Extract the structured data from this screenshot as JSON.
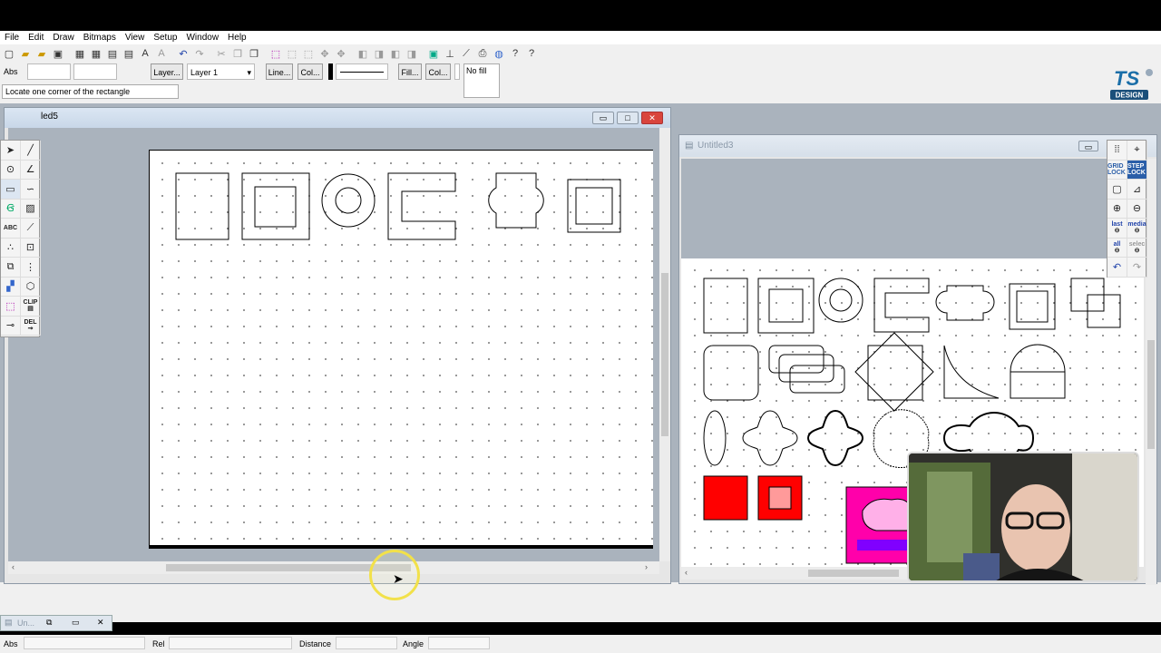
{
  "menu": [
    "File",
    "Edit",
    "Draw",
    "Bitmaps",
    "View",
    "Setup",
    "Window",
    "Help"
  ],
  "propbar": {
    "abs_label": "Abs",
    "layer_button": "Layer...",
    "layer_select": "Layer 1",
    "line_button": "Line...",
    "color_button": "Col...",
    "fill_button": "Fill...",
    "fill_color_button": "Col...",
    "fill_value": "No fill"
  },
  "prompt": "Locate one corner of the rectangle",
  "logo": {
    "text": "TS",
    "sub": "DESIGN"
  },
  "left_window": {
    "title": "led5"
  },
  "right_window": {
    "title": "Untitled3"
  },
  "minimized": {
    "title": "Un..."
  },
  "palette_left": [
    "ABC",
    "CLIP",
    "DEL"
  ],
  "palette_right": [
    "GRID LOCK",
    "STEP LOCK",
    "last",
    "media",
    "all",
    "selec"
  ],
  "statusbar": {
    "abs": "Abs",
    "rel": "Rel",
    "distance": "Distance",
    "angle": "Angle"
  },
  "colors": {
    "red": "#ff0000",
    "salmon": "#ff9a9a",
    "magenta": "#ff00aa",
    "pink": "#ffb0e8",
    "purple": "#8000ff",
    "workspace": "#aab3bd"
  }
}
